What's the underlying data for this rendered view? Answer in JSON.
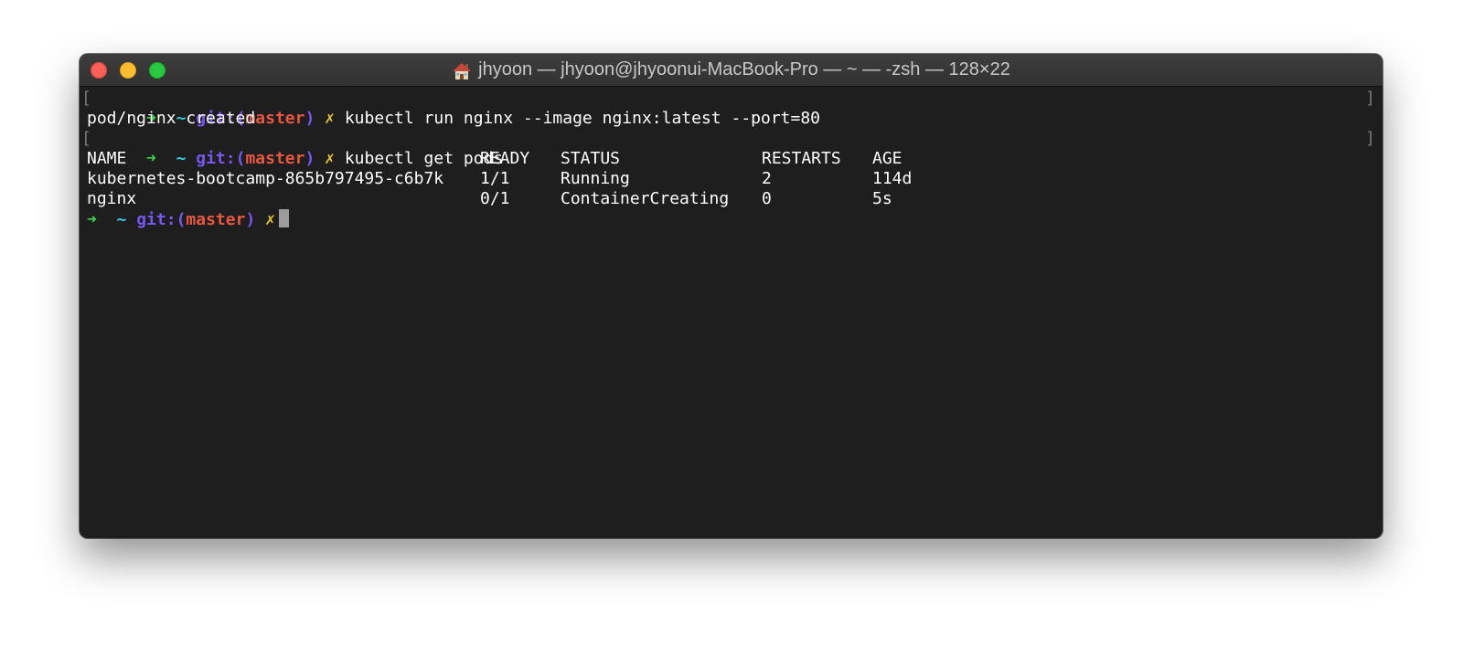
{
  "window": {
    "title": "jhyoon — jhyoon@jhyoonui-MacBook-Pro — ~ — -zsh — 128×22",
    "title_icon": "home-icon",
    "colors": {
      "background": "#1e1e1e",
      "prompt_arrow": "#3bd34b",
      "prompt_tilde": "#33c7de",
      "prompt_git": "#7856f5",
      "prompt_branch": "#e8573e",
      "prompt_dirty": "#e5c62c"
    }
  },
  "prompt": {
    "arrow": "➜",
    "dir": "~",
    "git_prefix": "git:(",
    "branch": "master",
    "git_suffix": ")",
    "dirty": "✗"
  },
  "terminal": {
    "bracket_left": "[",
    "bracket_right": "]",
    "command1": "kubectl run nginx --image nginx:latest --port=80",
    "output1": "pod/nginx created",
    "command2": "kubectl get pods",
    "table": {
      "headers": [
        "NAME",
        "READY",
        "STATUS",
        "RESTARTS",
        "AGE"
      ],
      "rows": [
        [
          "kubernetes-bootcamp-865b797495-c6b7k",
          "1/1",
          "Running",
          "2",
          "114d"
        ],
        [
          "nginx",
          "0/1",
          "ContainerCreating",
          "0",
          "5s"
        ]
      ]
    }
  }
}
